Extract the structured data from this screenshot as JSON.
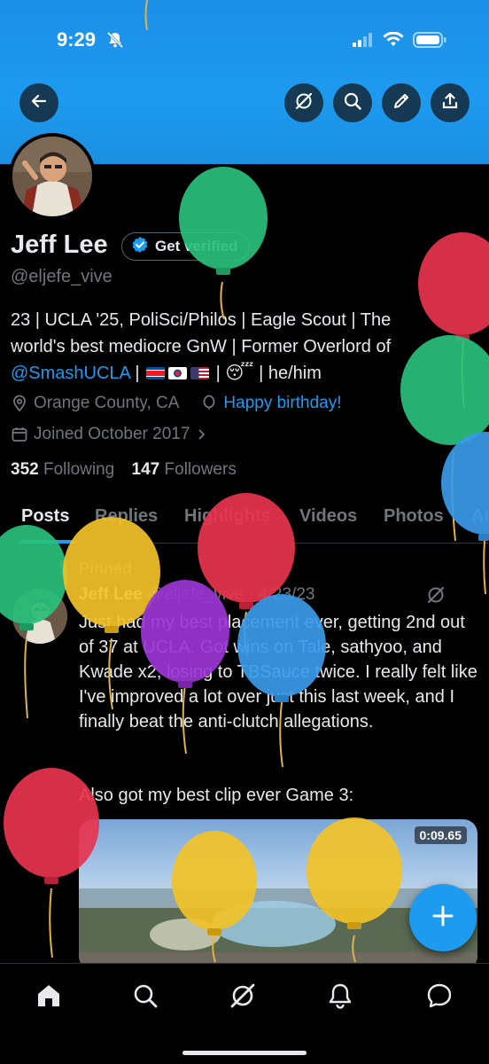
{
  "status": {
    "time": "9:29"
  },
  "profile": {
    "name": "Jeff Lee",
    "verify_label": "Get verified",
    "handle": "@eljefe_vive",
    "bio_line1": "23 | UCLA '25, PoliSci/Philos | Eagle Scout | The",
    "bio_line2": "world's best mediocre GnW | Former Overlord of",
    "bio_link": "@SmashUCLA",
    "bio_sep": " | ",
    "bio_emoji": "😴",
    "bio_pronouns": " | he/him",
    "location": "Orange County, CA",
    "birthday": "Happy birthday!",
    "joined": "Joined October 2017",
    "following_count": "352",
    "following_label": "Following",
    "followers_count": "147",
    "followers_label": "Followers"
  },
  "tabs": [
    {
      "label": "Posts"
    },
    {
      "label": "Replies"
    },
    {
      "label": "Highlights"
    },
    {
      "label": "Videos"
    },
    {
      "label": "Photos"
    },
    {
      "label": "Ar"
    }
  ],
  "post": {
    "pinned_label": "Pinned",
    "author": "Jeff Lee",
    "handle": "@eljefe_vive",
    "date": "4/23/23",
    "text": "Just had my best placement ever, getting 2nd out of 37 at UCLA. Got wins on Tale, sathyoo, and Kwade x2, losing to TBSauce twice. I really felt like I've improved a lot over just this last week, and I finally beat the anti-clutch allegations.",
    "text2": "Also got my best clip ever Game 3:",
    "video_time": "0:09.65"
  },
  "colors": {
    "accent": "#1d9bf0",
    "banner": "#1d9bf0",
    "background": "#000000",
    "muted": "#71767b"
  },
  "icons": {
    "back": "arrow-left-icon",
    "grok": "grok-icon",
    "search": "search-icon",
    "edit": "pencil-icon",
    "share": "share-icon",
    "compose": "plus-icon"
  }
}
